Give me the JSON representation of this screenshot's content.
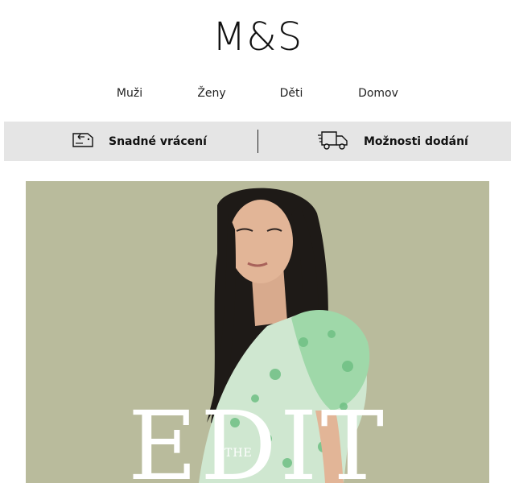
{
  "brand": {
    "logo": "M&S"
  },
  "nav": [
    {
      "label": "Muži"
    },
    {
      "label": "Ženy"
    },
    {
      "label": "Děti"
    },
    {
      "label": "Domov"
    }
  ],
  "info_strip": {
    "returns": {
      "label": "Snadné vrácení",
      "icon": "return-tag-icon"
    },
    "delivery": {
      "label": "Možnosti dodání",
      "icon": "delivery-truck-icon"
    }
  },
  "hero": {
    "title": "EDIT",
    "pre_title": "THE",
    "background_color": "#b9bb9c",
    "dress_color": "#8fd3a0"
  }
}
